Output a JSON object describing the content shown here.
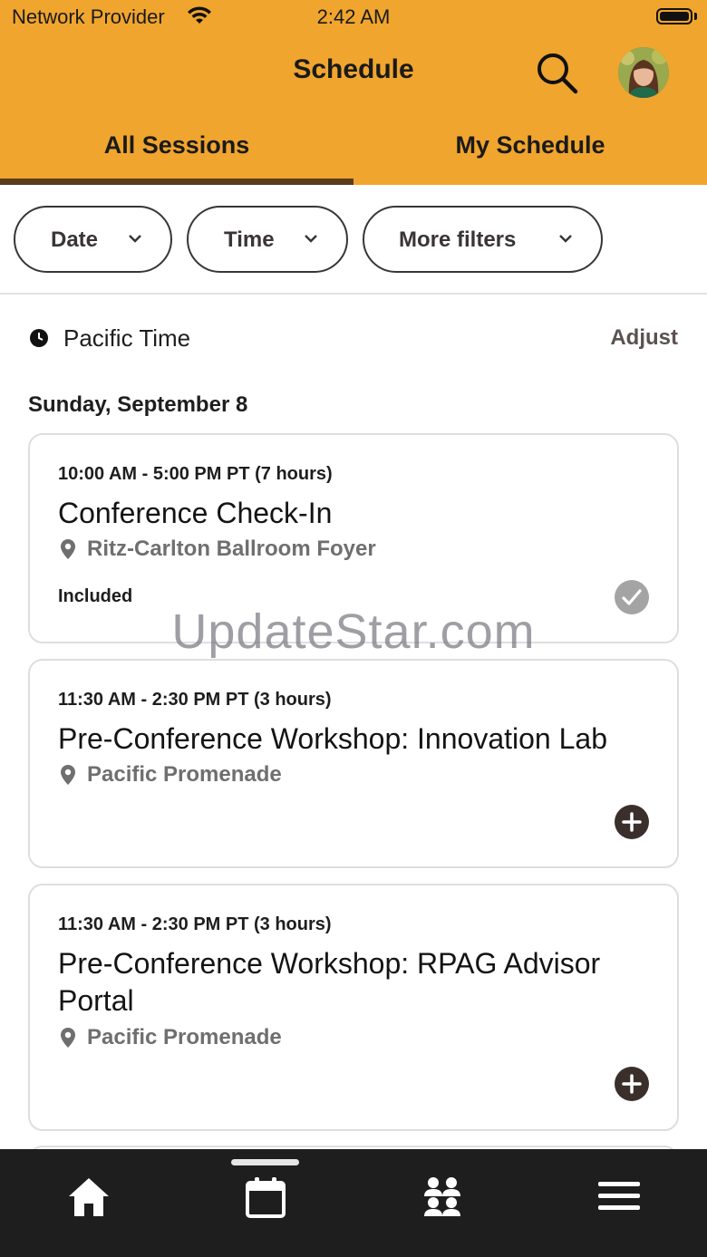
{
  "status_bar": {
    "carrier": "Network Provider",
    "time": "2:42 AM"
  },
  "header": {
    "title": "Schedule",
    "tabs": [
      {
        "label": "All Sessions",
        "selected": true
      },
      {
        "label": "My Schedule",
        "selected": false
      }
    ]
  },
  "filters": [
    {
      "label": "Date"
    },
    {
      "label": "Time"
    },
    {
      "label": "More filters"
    }
  ],
  "timezone": {
    "label": "Pacific Time",
    "adjust_label": "Adjust"
  },
  "day_heading": "Sunday, September 8",
  "sessions": [
    {
      "time": "10:00 AM - 5:00 PM PT (7 hours)",
      "title": "Conference Check-In",
      "location": "Ritz-Carlton Ballroom Foyer",
      "status": "Included",
      "action": "included-check-icon"
    },
    {
      "time": "11:30 AM - 2:30 PM PT (3 hours)",
      "title": "Pre-Conference Workshop: Innovation Lab",
      "location": "Pacific Promenade",
      "action": "add-icon"
    },
    {
      "time": "11:30 AM - 2:30 PM PT (3 hours)",
      "title": "Pre-Conference Workshop: RPAG Advisor Portal",
      "location": "Pacific Promenade",
      "action": "add-icon"
    }
  ],
  "watermark": "UpdateStar.com",
  "tab_bar": {
    "items": [
      "home-icon",
      "calendar-icon",
      "people-icon",
      "menu-icon"
    ],
    "selected": "calendar-icon"
  },
  "colors": {
    "header": "#f0a52e",
    "tab_underline": "#5b3c1c",
    "tab_bar": "#1e1e1e"
  }
}
